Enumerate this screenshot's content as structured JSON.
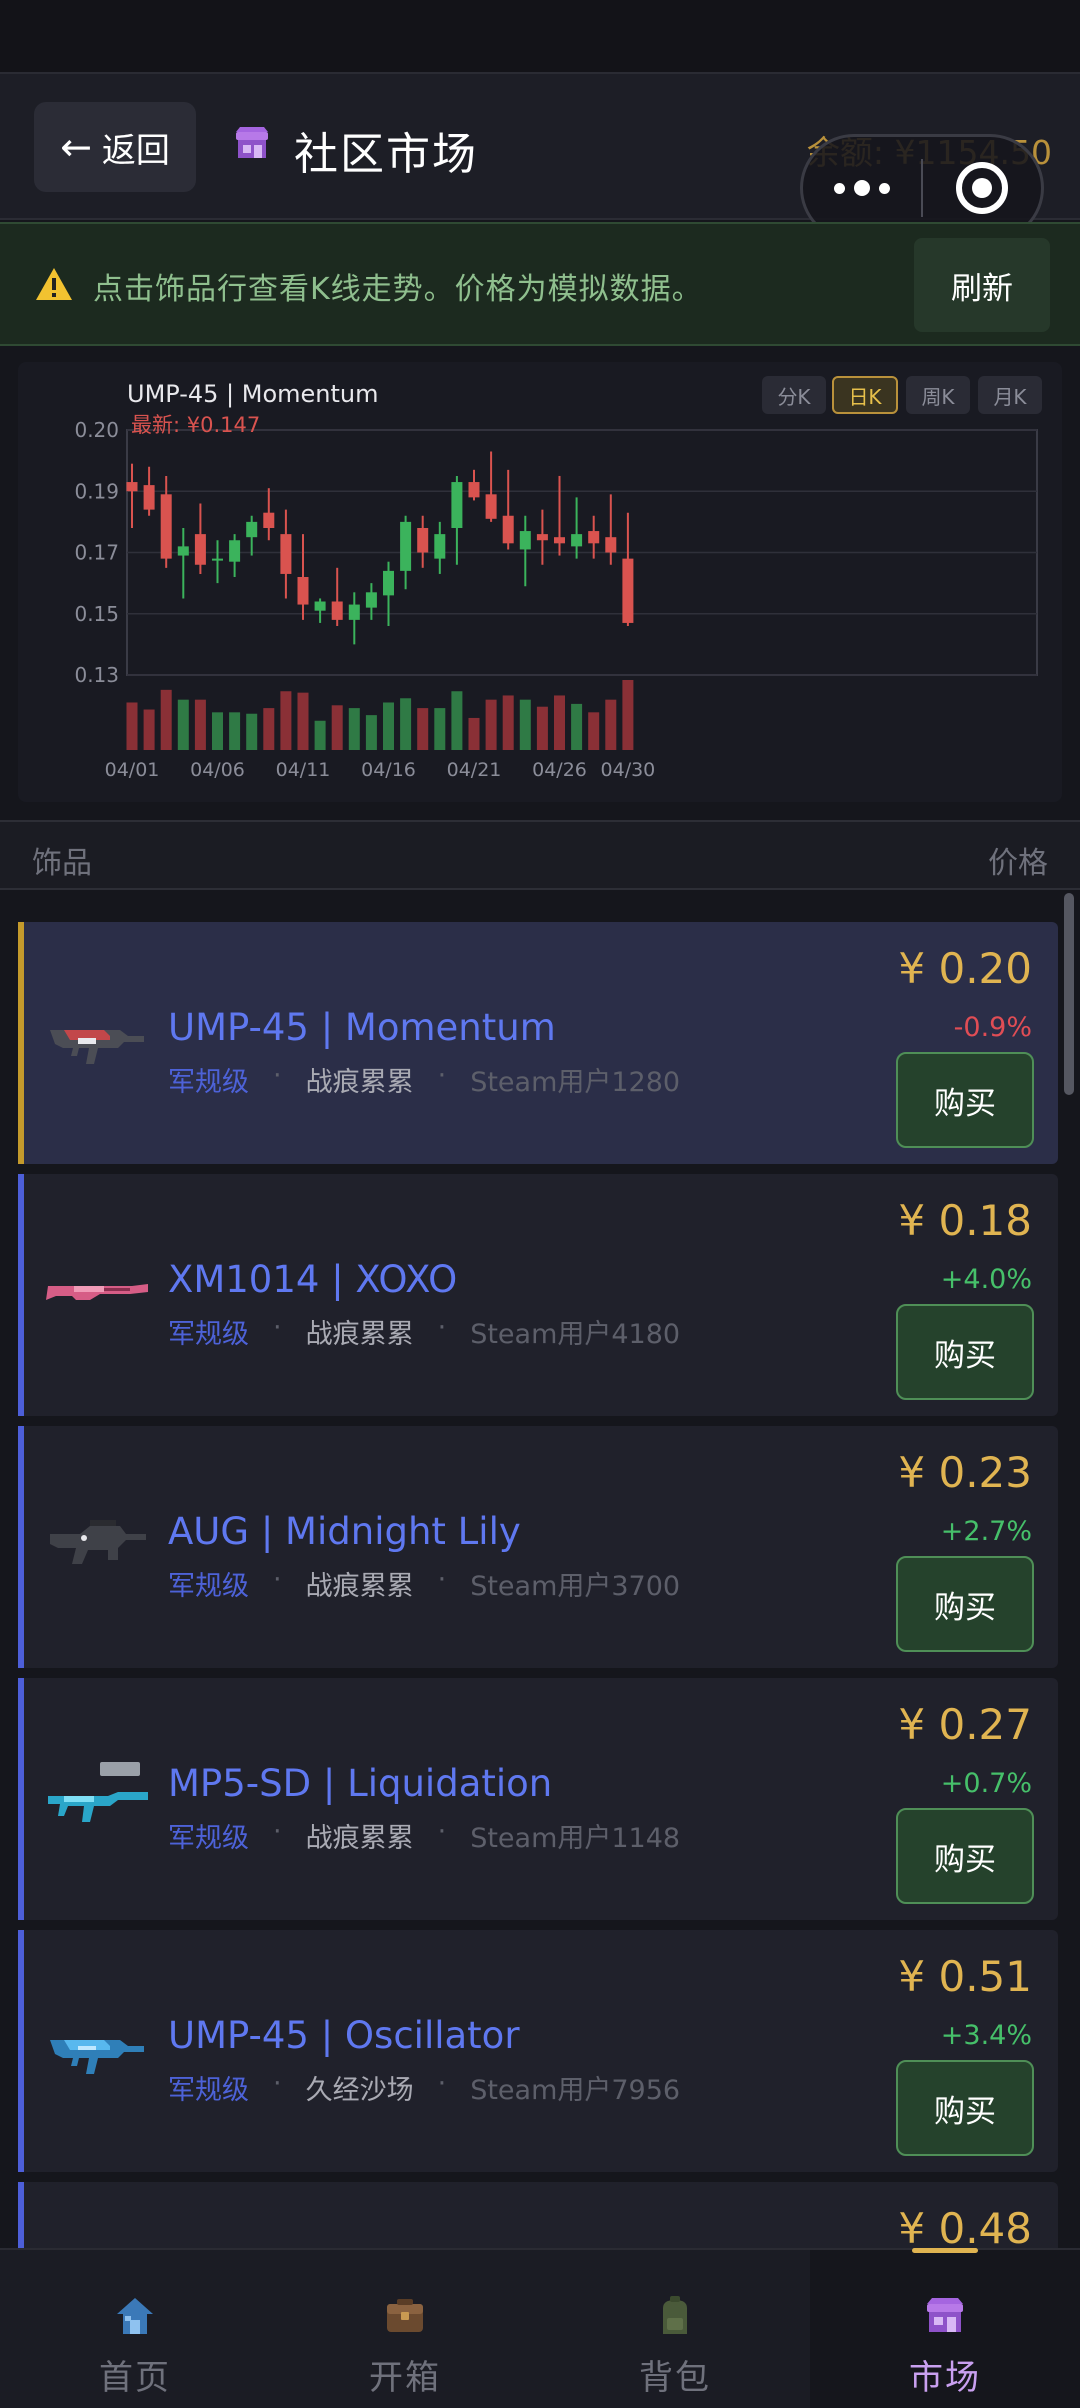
{
  "header": {
    "back_label": "返回",
    "back_arrow": "←",
    "title": "社区市场",
    "balance": "余额: ¥1154.50"
  },
  "notice": {
    "text": "点击饰品行查看K线走势。价格为模拟数据。",
    "refresh_label": "刷新"
  },
  "chart_panel": {
    "title": "UMP-45 | Momentum",
    "latest": "最新: ¥0.147",
    "period_buttons": [
      "分K",
      "日K",
      "周K",
      "月K"
    ],
    "active_period": "日K"
  },
  "chart_data": {
    "type": "candlestick",
    "title": "UMP-45 | Momentum",
    "subtitle": "最新: ¥0.147",
    "ylim": [
      0.13,
      0.21
    ],
    "yticks": [
      "0.20",
      "0.19",
      "0.17",
      "0.15",
      "0.13"
    ],
    "xticks": [
      "04/01",
      "04/06",
      "04/11",
      "04/16",
      "04/21",
      "04/26",
      "04/30"
    ],
    "candles": [
      {
        "o": 0.193,
        "h": 0.199,
        "l": 0.178,
        "c": 0.19
      },
      {
        "o": 0.192,
        "h": 0.198,
        "l": 0.182,
        "c": 0.184
      },
      {
        "o": 0.189,
        "h": 0.195,
        "l": 0.165,
        "c": 0.168
      },
      {
        "o": 0.169,
        "h": 0.178,
        "l": 0.155,
        "c": 0.172
      },
      {
        "o": 0.176,
        "h": 0.186,
        "l": 0.163,
        "c": 0.166
      },
      {
        "o": 0.168,
        "h": 0.174,
        "l": 0.16,
        "c": 0.168
      },
      {
        "o": 0.167,
        "h": 0.176,
        "l": 0.162,
        "c": 0.174
      },
      {
        "o": 0.175,
        "h": 0.182,
        "l": 0.169,
        "c": 0.18
      },
      {
        "o": 0.183,
        "h": 0.191,
        "l": 0.174,
        "c": 0.178
      },
      {
        "o": 0.176,
        "h": 0.184,
        "l": 0.155,
        "c": 0.163
      },
      {
        "o": 0.162,
        "h": 0.176,
        "l": 0.148,
        "c": 0.153
      },
      {
        "o": 0.151,
        "h": 0.155,
        "l": 0.147,
        "c": 0.154
      },
      {
        "o": 0.154,
        "h": 0.165,
        "l": 0.146,
        "c": 0.148
      },
      {
        "o": 0.148,
        "h": 0.157,
        "l": 0.14,
        "c": 0.153
      },
      {
        "o": 0.152,
        "h": 0.16,
        "l": 0.148,
        "c": 0.157
      },
      {
        "o": 0.156,
        "h": 0.167,
        "l": 0.146,
        "c": 0.164
      },
      {
        "o": 0.164,
        "h": 0.182,
        "l": 0.158,
        "c": 0.18
      },
      {
        "o": 0.178,
        "h": 0.182,
        "l": 0.165,
        "c": 0.17
      },
      {
        "o": 0.168,
        "h": 0.18,
        "l": 0.163,
        "c": 0.176
      },
      {
        "o": 0.178,
        "h": 0.195,
        "l": 0.166,
        "c": 0.193
      },
      {
        "o": 0.193,
        "h": 0.197,
        "l": 0.187,
        "c": 0.188
      },
      {
        "o": 0.189,
        "h": 0.203,
        "l": 0.18,
        "c": 0.181
      },
      {
        "o": 0.182,
        "h": 0.197,
        "l": 0.171,
        "c": 0.173
      },
      {
        "o": 0.171,
        "h": 0.182,
        "l": 0.159,
        "c": 0.177
      },
      {
        "o": 0.176,
        "h": 0.184,
        "l": 0.166,
        "c": 0.174
      },
      {
        "o": 0.175,
        "h": 0.195,
        "l": 0.169,
        "c": 0.173
      },
      {
        "o": 0.172,
        "h": 0.188,
        "l": 0.168,
        "c": 0.176
      },
      {
        "o": 0.177,
        "h": 0.182,
        "l": 0.168,
        "c": 0.173
      },
      {
        "o": 0.175,
        "h": 0.189,
        "l": 0.166,
        "c": 0.17
      },
      {
        "o": 0.168,
        "h": 0.183,
        "l": 0.146,
        "c": 0.147
      }
    ],
    "colors": {
      "up": "#3bb35c",
      "down": "#d9534f",
      "grid": "#2f303a",
      "axis": "#8b8d99"
    }
  },
  "list_header": {
    "left": "饰品",
    "right": "价格"
  },
  "items": [
    {
      "name": "UMP-45 | Momentum",
      "rarity": "军规级",
      "wear": "战痕累累",
      "seller": "Steam用户1280",
      "price": "¥ 0.20",
      "change": "-0.9%",
      "trend": "neg",
      "buy": "购买",
      "icon": "ump45-momentum-thumb"
    },
    {
      "name": "XM1014 | XOXO",
      "rarity": "军规级",
      "wear": "战痕累累",
      "seller": "Steam用户4180",
      "price": "¥ 0.18",
      "change": "+4.0%",
      "trend": "pos",
      "buy": "购买",
      "icon": "xm1014-xoxo-thumb"
    },
    {
      "name": "AUG | Midnight Lily",
      "rarity": "军规级",
      "wear": "战痕累累",
      "seller": "Steam用户3700",
      "price": "¥ 0.23",
      "change": "+2.7%",
      "trend": "pos",
      "buy": "购买",
      "icon": "aug-midnight-lily-thumb"
    },
    {
      "name": "MP5-SD | Liquidation",
      "rarity": "军规级",
      "wear": "战痕累累",
      "seller": "Steam用户1148",
      "price": "¥ 0.27",
      "change": "+0.7%",
      "trend": "pos",
      "buy": "购买",
      "icon": "mp5sd-liquidation-thumb"
    },
    {
      "name": "UMP-45 | Oscillator",
      "rarity": "军规级",
      "wear": "久经沙场",
      "seller": "Steam用户7956",
      "price": "¥ 0.51",
      "change": "+3.4%",
      "trend": "pos",
      "buy": "购买",
      "icon": "ump45-oscillator-thumb"
    },
    {
      "price": "¥ 0.48"
    }
  ],
  "tabs": [
    {
      "label": "首页",
      "icon": "home-icon"
    },
    {
      "label": "开箱",
      "icon": "case-icon"
    },
    {
      "label": "背包",
      "icon": "backpack-icon"
    },
    {
      "label": "市场",
      "icon": "shop-icon",
      "active": true
    }
  ],
  "colors": {
    "accent_gold": "#e0b451",
    "accent_blue": "#5f78f0",
    "positive": "#46c06a",
    "negative": "#e04d55",
    "buy_bg": "#25422c",
    "active_tab": "#c9a0f0"
  }
}
